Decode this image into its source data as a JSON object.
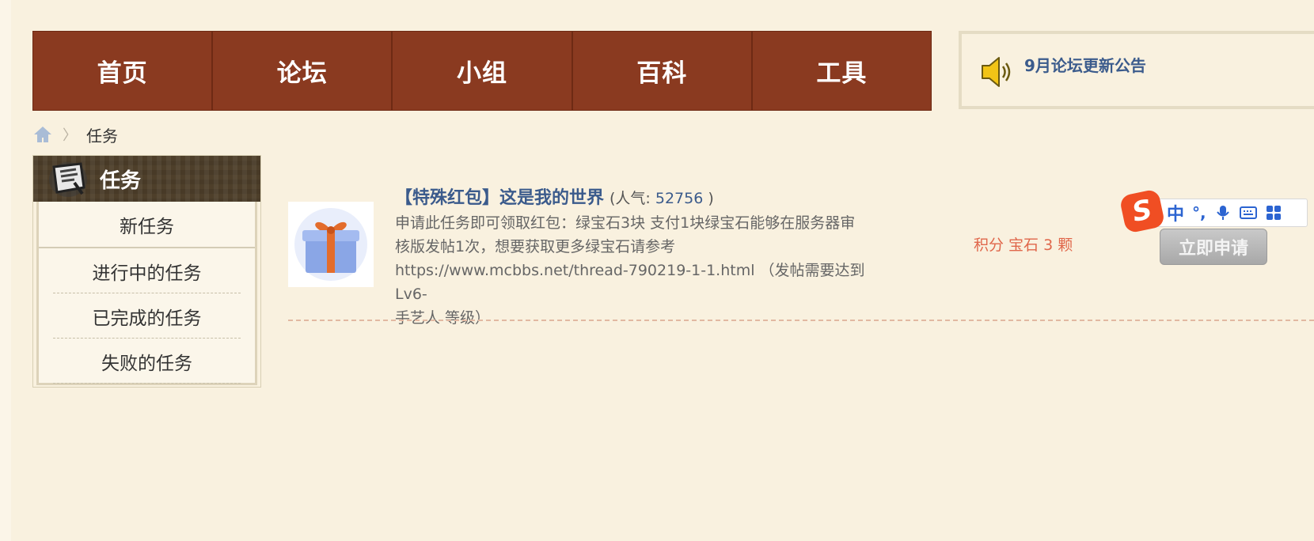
{
  "nav": {
    "items": [
      "首页",
      "论坛",
      "小组",
      "百科",
      "工具"
    ]
  },
  "notice": {
    "text": "9月论坛更新公告"
  },
  "breadcrumb": {
    "sep": "〉",
    "current": "任务"
  },
  "sidebar": {
    "title": "任务",
    "items": [
      "新任务",
      "进行中的任务",
      "已完成的任务",
      "失败的任务"
    ]
  },
  "task": {
    "title": "【特殊红包】这是我的世界",
    "popularity_prefix": "(人气: ",
    "popularity": "52756",
    "popularity_suffix": " )",
    "desc_lines": [
      "申请此任务即可领取红包：绿宝石3块 支付1块绿宝石能够在服务器审",
      "核版发帖1次，想要获取更多绿宝石请参考",
      "https://www.mcbbs.net/thread-790219-1-1.html （发帖需要达到 Lv6-",
      "手艺人 等级）"
    ],
    "reward": "积分 宝石 3 颗",
    "apply_label": "立即申请"
  },
  "ime": {
    "logo": "S",
    "mode": "中",
    "punct": "°,"
  },
  "colors": {
    "nav_bg": "#8a3a20",
    "page_bg": "#f9f1df",
    "link": "#3b5b8c",
    "reward": "#e0674b"
  }
}
